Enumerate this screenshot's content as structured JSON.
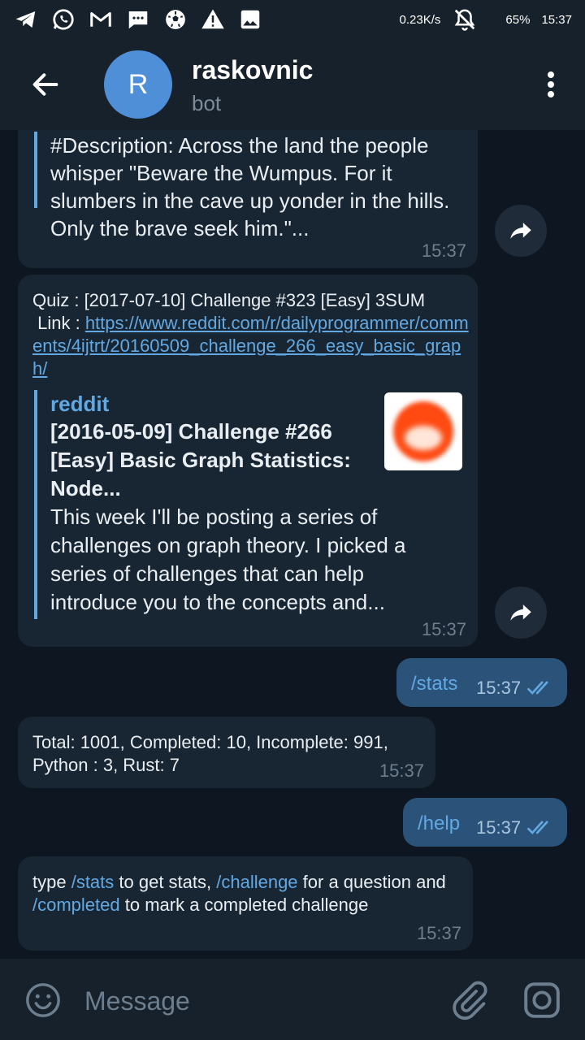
{
  "status_bar": {
    "net_speed": "0.23K/s",
    "battery": "65%",
    "clock": "15:37"
  },
  "header": {
    "avatar_letter": "R",
    "title": "raskovnic",
    "subtitle": "bot"
  },
  "messages": {
    "m1": {
      "desc_text": "#Description: Across the land the people whisper \"Beware the Wumpus. For it slumbers in the cave up yonder in the hills. Only the brave seek him.\"...",
      "time": "15:37"
    },
    "m2": {
      "quiz_text": "Quiz : [2017-07-10] Challenge #323 [Easy] 3SUM",
      "link_label": " Link : ",
      "link_url": "https://www.reddit.com/r/dailyprogrammer/comments/4ijtrt/20160509_challenge_266_easy_basic_graph/",
      "preview_site": "reddit",
      "preview_title": "[2016-05-09] Challenge #266 [Easy] Basic Graph Statistics: Node...",
      "preview_desc": "This week I'll be posting a series of challenges on graph theory. I picked a series of challenges that can help introduce you to the concepts and...",
      "time": "15:37"
    },
    "m3": {
      "text": "/stats",
      "time": "15:37"
    },
    "m4": {
      "text": "Total: 1001, Completed: 10, Incomplete: 991, Python : 3, Rust: 7",
      "time": "15:37"
    },
    "m5": {
      "text": "/help",
      "time": "15:37"
    },
    "m6": {
      "t1": "type ",
      "cmd1": "/stats",
      "t2": " to get stats, ",
      "cmd2": "/challenge",
      "t3": " for a question and ",
      "cmd3": "/completed",
      "t4": " to mark a completed challenge",
      "time": "15:37"
    }
  },
  "composer": {
    "placeholder": "Message"
  },
  "colors": {
    "background": "#0e1621",
    "bar": "#17212b",
    "incoming_bubble": "#182533",
    "outgoing_bubble": "#2b5278",
    "accent": "#62a9e3",
    "avatar": "#4f8fd8"
  },
  "icons": {
    "status": [
      "telegram-icon",
      "whatsapp-icon",
      "gmail-icon",
      "sms-icon",
      "soccer-ball-icon",
      "warning-icon",
      "image-icon"
    ],
    "status_right": [
      "notifications-off-icon"
    ],
    "header": [
      "back-arrow-icon",
      "more-vertical-icon"
    ],
    "message": [
      "share-forward-icon",
      "double-check-icon"
    ],
    "composer": [
      "emoji-icon",
      "attach-icon",
      "camera-icon"
    ]
  }
}
